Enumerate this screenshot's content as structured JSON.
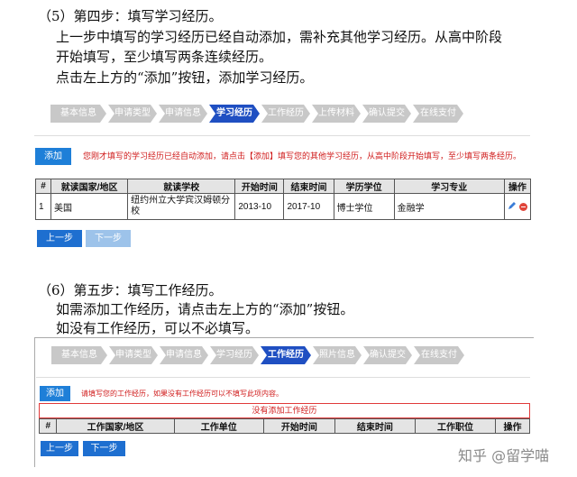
{
  "step5": {
    "heading": "（5）第四步：填写学习经历。",
    "line1": "上一步中填写的学习经历已经自动添加，需补充其他学习经历。从高中阶段",
    "line2": "开始填写，至少填写两条连续经历。",
    "line3": "点击左上方的“添加”按钮，添加学习经历。"
  },
  "steps_a": [
    "基本信息",
    "申请类型",
    "申请信息",
    "学习经历",
    "工作经历",
    "上传材料",
    "确认提交",
    "在线支付"
  ],
  "steps_b": [
    "基本信息",
    "申请类型",
    "申请信息",
    "学习经历",
    "工作经历",
    "照片信息",
    "确认提交",
    "在线支付"
  ],
  "study": {
    "add_label": "添加",
    "note": "您刚才填写的学习经历已经自动添加，请点击【添加】填写您的其他学习经历，从高中阶段开始填写，至少填写两条经历。",
    "columns": [
      "#",
      "就读国家/地区",
      "就读学校",
      "开始时间",
      "结束时间",
      "学历学位",
      "学习专业",
      "操作"
    ],
    "row": {
      "num": "1",
      "country": "美国",
      "school": "纽约州立大学宾汉姆顿分校",
      "start": "2013-10",
      "end": "2017-10",
      "degree": "博士学位",
      "major": "金融学"
    },
    "prev_label": "上一步",
    "next_label": "下一步"
  },
  "step6": {
    "heading": "（6）第五步：填写工作经历。",
    "line1": "如需添加工作经历，请点击左上方的“添加”按钮。",
    "line2": "如没有工作经历，可以不必填写。"
  },
  "work": {
    "add_label": "添加",
    "note": "请填写您的工作经历，如果没有工作经历可以不填写此项内容。",
    "empty_msg": "没有添加工作经历",
    "columns": [
      "#",
      "工作国家/地区",
      "工作单位",
      "开始时间",
      "结束时间",
      "工作职位",
      "操作"
    ],
    "prev_label": "上一步",
    "next_label": "下一步"
  },
  "watermark": "知乎 @留学喵",
  "colors": {
    "active_step": "#1f4fc2",
    "inactive_step": "#c8c8c8",
    "note": "#d01c1c",
    "button": "#1e7fd8"
  }
}
